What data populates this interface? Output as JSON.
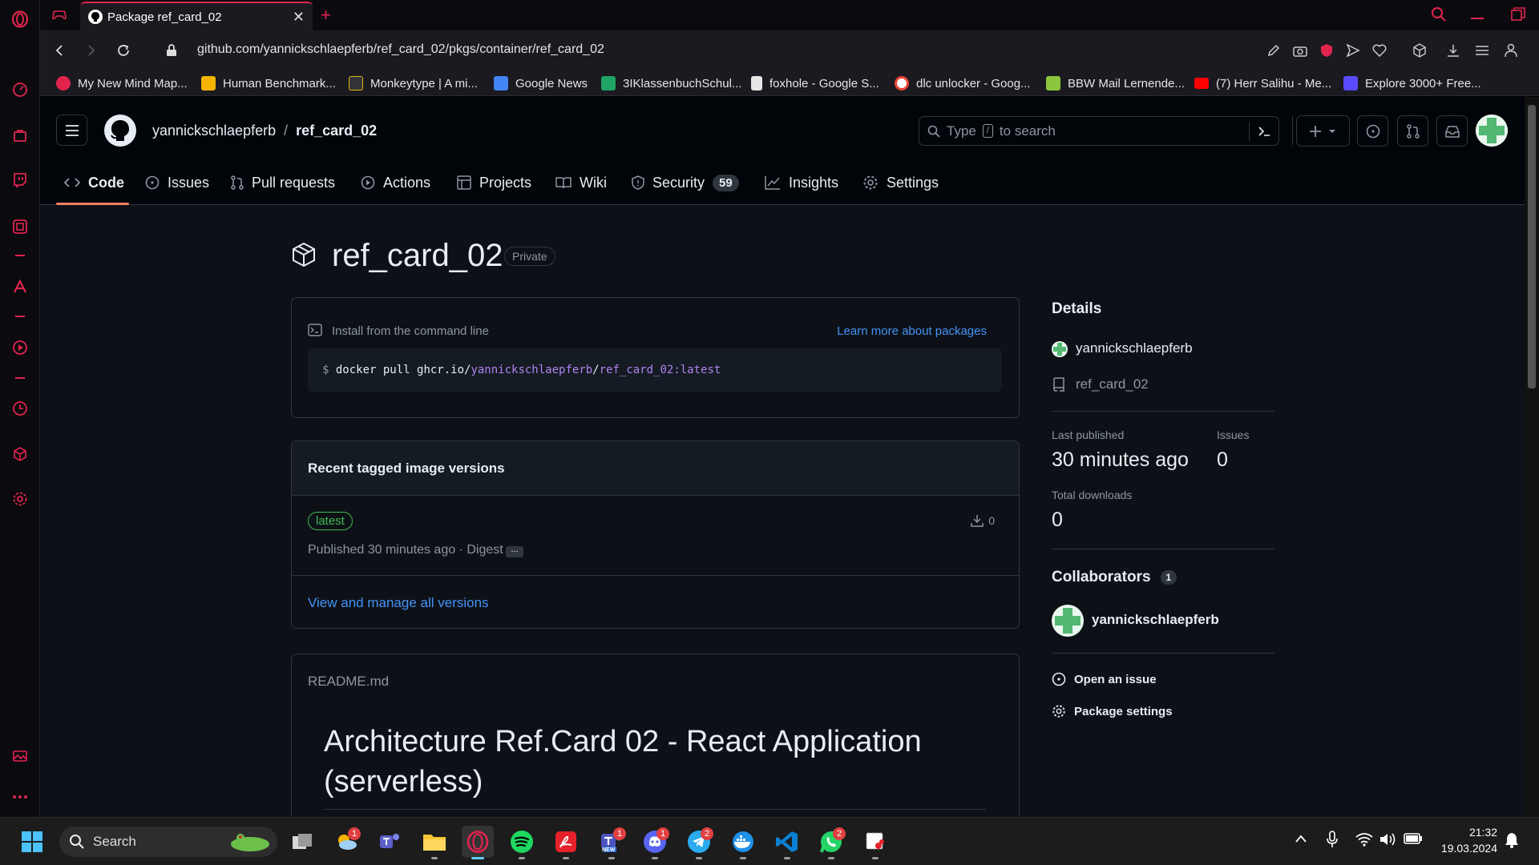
{
  "browser": {
    "tab_title": "Package ref_card_02",
    "url": "github.com/yannickschlaepferb/ref_card_02/pkgs/container/ref_card_02",
    "bookmarks": [
      {
        "label": "My New Mind Map...",
        "color": "#e0244d"
      },
      {
        "label": "Human Benchmark...",
        "color": "#f5b400"
      },
      {
        "label": "Monkeytype | A mi...",
        "color": "#323437"
      },
      {
        "label": "Google News",
        "color": "#4285f4"
      },
      {
        "label": "3IKlassenbuchSchul...",
        "color": "#21a366"
      },
      {
        "label": "foxhole - Google S...",
        "color": "#e6e6e6"
      },
      {
        "label": "dlc unlocker - Goog...",
        "color": "#ffffff"
      },
      {
        "label": "BBW Mail Lernende...",
        "color": "#8cc63f"
      },
      {
        "label": "(7) Herr Salihu - Me...",
        "color": "#ff0000"
      },
      {
        "label": "Explore 3000+ Free...",
        "color": "#5b4bff"
      }
    ]
  },
  "github": {
    "owner": "yannickschlaepferb",
    "repo": "ref_card_02",
    "search_placeholder_1": "Type",
    "search_key": "/",
    "search_placeholder_2": "to search",
    "tabs": [
      {
        "label": "Code",
        "icon": "code-icon"
      },
      {
        "label": "Issues",
        "icon": "issue-icon"
      },
      {
        "label": "Pull requests",
        "icon": "pull-request-icon"
      },
      {
        "label": "Actions",
        "icon": "play-icon"
      },
      {
        "label": "Projects",
        "icon": "table-icon"
      },
      {
        "label": "Wiki",
        "icon": "book-icon"
      },
      {
        "label": "Security",
        "icon": "shield-icon",
        "counter": "59"
      },
      {
        "label": "Insights",
        "icon": "graph-icon"
      },
      {
        "label": "Settings",
        "icon": "gear-icon"
      }
    ],
    "package": {
      "name": "ref_card_02",
      "visibility": "Private",
      "install_label": "Install from the command line",
      "learn_more": "Learn more about packages",
      "cmd_prefix": "$",
      "cmd_base": "docker pull ghcr.io/",
      "cmd_owner": "yannickschlaepferb",
      "cmd_slash": "/",
      "cmd_image": "ref_card_02:latest",
      "versions_title": "Recent tagged image versions",
      "version_tag": "latest",
      "version_downloads": "0",
      "version_published": "Published 30 minutes ago · Digest",
      "version_digest_button": "...",
      "view_all": "View and manage all versions",
      "readme_label": "README.md",
      "readme_heading": "Architecture Ref.Card 02 - React Application (serverless)"
    },
    "details": {
      "title": "Details",
      "owner": "yannickschlaepferb",
      "repo": "ref_card_02",
      "last_published_label": "Last published",
      "last_published_value": "30 minutes ago",
      "issues_label": "Issues",
      "issues_value": "0",
      "downloads_label": "Total downloads",
      "downloads_value": "0",
      "collaborators_label": "Collaborators",
      "collaborators_count": "1",
      "collaborator_name": "yannickschlaepferb",
      "open_issue": "Open an issue",
      "package_settings": "Package settings"
    }
  },
  "taskbar": {
    "search_label": "Search",
    "time": "21:32",
    "date": "19.03.2024",
    "badges": {
      "weather": "1",
      "teams": "1",
      "discord": "1",
      "telegram": "2",
      "whatsapp": "2"
    },
    "teams_new": "NEW"
  },
  "colors": {
    "accent": "#e0244d",
    "github_bg": "#0d1117",
    "link": "#4493f8",
    "green": "#3fb950"
  }
}
